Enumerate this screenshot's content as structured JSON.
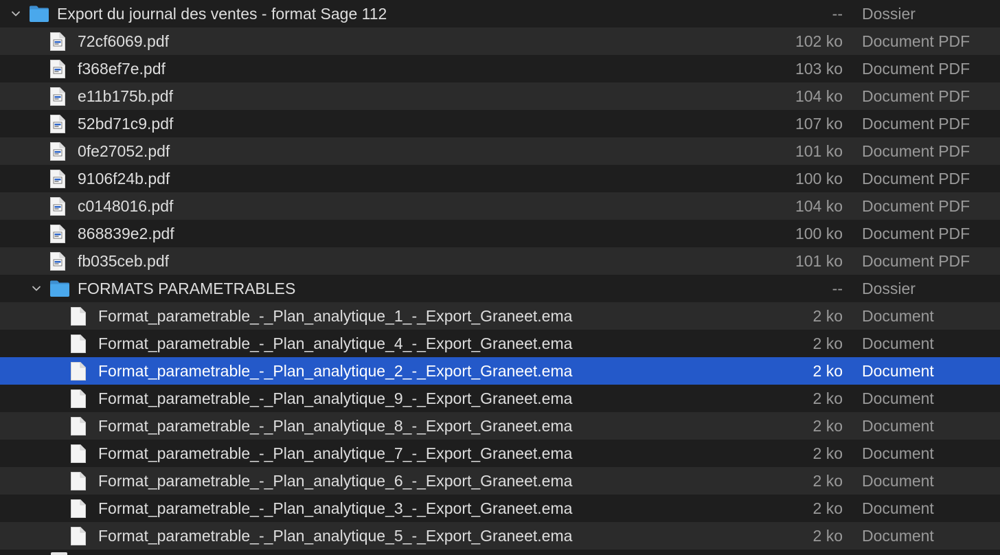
{
  "finder_list": {
    "rows": [
      {
        "name": "Export du journal des ventes - format Sage 112",
        "size": "--",
        "kind": "Dossier",
        "icon": "folder-icon",
        "expanded": true
      },
      {
        "name": "72cf6069.pdf",
        "size": "102 ko",
        "kind": "Document PDF",
        "icon": "pdf-file-icon"
      },
      {
        "name": "f368ef7e.pdf",
        "size": "103 ko",
        "kind": "Document PDF",
        "icon": "pdf-file-icon"
      },
      {
        "name": "e11b175b.pdf",
        "size": "104 ko",
        "kind": "Document PDF",
        "icon": "pdf-file-icon"
      },
      {
        "name": "52bd71c9.pdf",
        "size": "107 ko",
        "kind": "Document PDF",
        "icon": "pdf-file-icon"
      },
      {
        "name": "0fe27052.pdf",
        "size": "101 ko",
        "kind": "Document PDF",
        "icon": "pdf-file-icon"
      },
      {
        "name": "9106f24b.pdf",
        "size": "100 ko",
        "kind": "Document PDF",
        "icon": "pdf-file-icon"
      },
      {
        "name": "c0148016.pdf",
        "size": "104 ko",
        "kind": "Document PDF",
        "icon": "pdf-file-icon"
      },
      {
        "name": "868839e2.pdf",
        "size": "100 ko",
        "kind": "Document PDF",
        "icon": "pdf-file-icon"
      },
      {
        "name": "fb035ceb.pdf",
        "size": "101 ko",
        "kind": "Document PDF",
        "icon": "pdf-file-icon"
      },
      {
        "name": "FORMATS PARAMETRABLES",
        "size": "--",
        "kind": "Dossier",
        "icon": "folder-icon",
        "expanded": true
      },
      {
        "name": "Format_parametrable_-_Plan_analytique_1_-_Export_Graneet.ema",
        "size": "2 ko",
        "kind": "Document",
        "icon": "blank-file-icon"
      },
      {
        "name": "Format_parametrable_-_Plan_analytique_4_-_Export_Graneet.ema",
        "size": "2 ko",
        "kind": "Document",
        "icon": "blank-file-icon"
      },
      {
        "name": "Format_parametrable_-_Plan_analytique_2_-_Export_Graneet.ema",
        "size": "2 ko",
        "kind": "Document",
        "icon": "blank-file-icon",
        "selected": true
      },
      {
        "name": "Format_parametrable_-_Plan_analytique_9_-_Export_Graneet.ema",
        "size": "2 ko",
        "kind": "Document",
        "icon": "blank-file-icon"
      },
      {
        "name": "Format_parametrable_-_Plan_analytique_8_-_Export_Graneet.ema",
        "size": "2 ko",
        "kind": "Document",
        "icon": "blank-file-icon"
      },
      {
        "name": "Format_parametrable_-_Plan_analytique_7_-_Export_Graneet.ema",
        "size": "2 ko",
        "kind": "Document",
        "icon": "blank-file-icon"
      },
      {
        "name": "Format_parametrable_-_Plan_analytique_6_-_Export_Graneet.ema",
        "size": "2 ko",
        "kind": "Document",
        "icon": "blank-file-icon"
      },
      {
        "name": "Format_parametrable_-_Plan_analytique_3_-_Export_Graneet.ema",
        "size": "2 ko",
        "kind": "Document",
        "icon": "blank-file-icon"
      },
      {
        "name": "Format_parametrable_-_Plan_analytique_5_-_Export_Graneet.ema",
        "size": "2 ko",
        "kind": "Document",
        "icon": "blank-file-icon"
      }
    ],
    "colors": {
      "background_dark": "#1e1e1e",
      "background_light": "#2b2b2b",
      "selection": "#2459c9",
      "folder_blue": "#49a6e9",
      "text_primary": "#dedede",
      "text_secondary": "#9a9a9a"
    }
  }
}
